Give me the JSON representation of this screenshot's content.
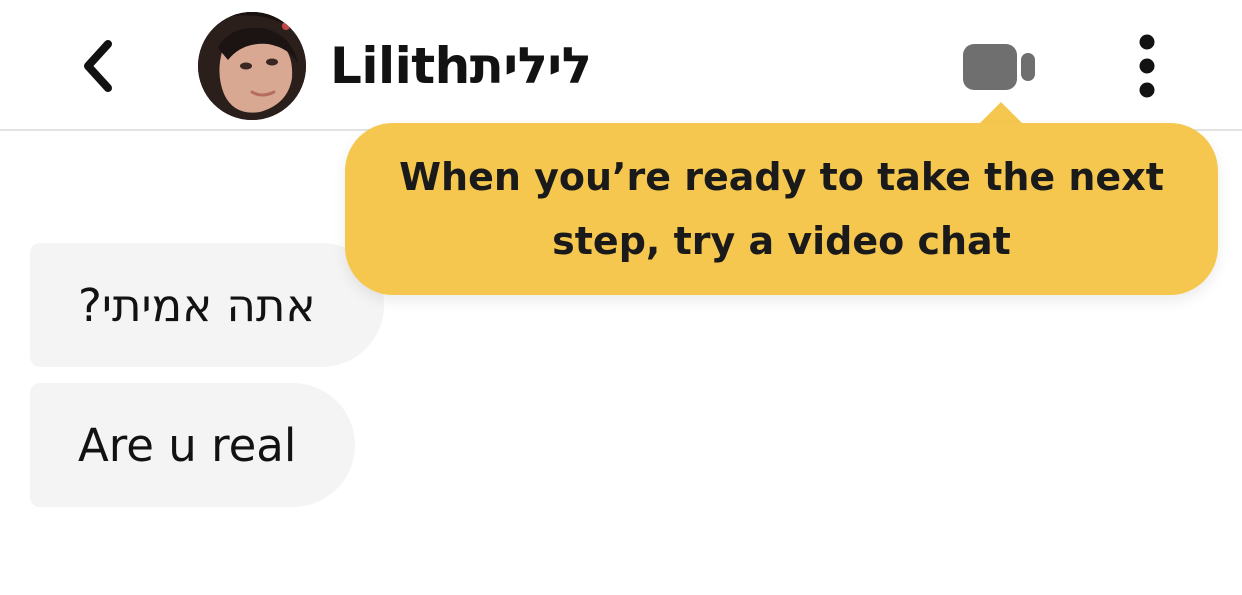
{
  "header": {
    "contact_name": "Lilithלילית",
    "back_icon": "chevron-left-icon",
    "video_icon": "video-camera-icon",
    "more_icon": "more-vertical-icon"
  },
  "tooltip": {
    "line1": "When you’re ready to take the next",
    "line2": "step, try a video chat"
  },
  "messages": [
    {
      "text": "אתה אמיתי?"
    },
    {
      "text": "Are u real"
    }
  ],
  "colors": {
    "tooltip": "#f5c74f",
    "bubble": "#f4f4f4",
    "video_icon": "#6f6f6f",
    "text": "#121212"
  }
}
